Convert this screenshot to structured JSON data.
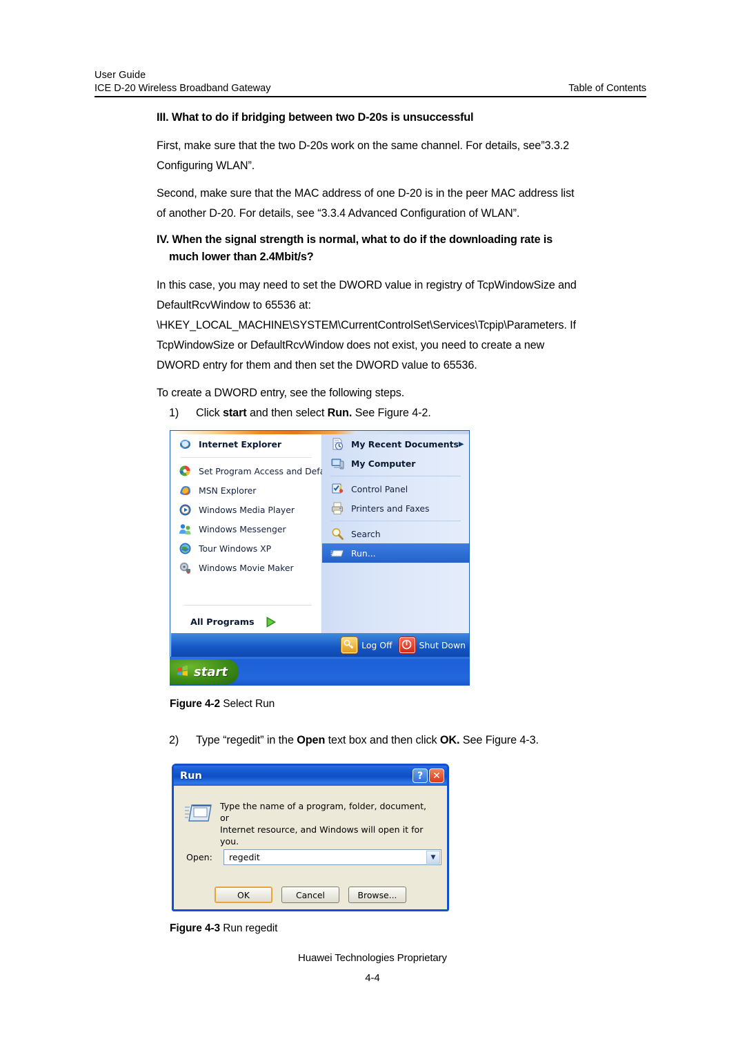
{
  "header": {
    "doc_type": "User Guide",
    "product": "ICE D-20 Wireless Broadband Gateway",
    "right_label": "Table of Contents"
  },
  "content": {
    "heading_3": "III. What to do if bridging between two D-20s is unsuccessful",
    "para_first_1": "First, make sure that the two D-20s work on the same channel. For details, see”3.3.2",
    "para_first_2": "Configuring WLAN”.",
    "para_second_1": "Second, make sure that the MAC address of one D-20 is in the peer MAC address list",
    "para_second_2": "of another D-20. For details, see “3.3.4  Advanced Configuration of WLAN”.",
    "heading_4_line1": "IV. When the signal strength is normal, what to do if the downloading rate is",
    "heading_4_line2": "much lower than 2.4Mbit/s?",
    "para_case_1": "In this case, you may need to set the DWORD value in registry of TcpWindowSize and",
    "para_case_2": "DefaultRcvWindow to 65536 at:",
    "para_case_3": "\\HKEY_LOCAL_MACHINE\\SYSTEM\\CurrentControlSet\\Services\\Tcpip\\Parameters. If",
    "para_case_4": "TcpWindowSize or DefaultRcvWindow does not exist, you need to create a new",
    "para_case_5": "DWORD entry for them and then set the DWORD value to 65536.",
    "para_steps_intro": "To create a DWORD entry, see the following steps.",
    "step1": {
      "number": "1)",
      "text_a": "Click ",
      "bold_a": "start",
      "text_b": " and then select ",
      "bold_b": "Run.",
      "text_c": " See Figure 4-2."
    },
    "step2": {
      "number": "2)",
      "text_a": "Type “regedit” in the ",
      "bold_a": "Open",
      "text_b": " text box and then click ",
      "bold_b": "OK.",
      "text_c": " See Figure 4-3."
    },
    "figure_4_2": {
      "label": "Figure 4-2",
      "caption": " Select Run"
    },
    "figure_4_3": {
      "label": "Figure 4-3",
      "caption": " Run regedit"
    }
  },
  "start_menu": {
    "left_items": [
      {
        "label": "Internet Explorer",
        "icon": "internet-explorer-icon",
        "bold": true
      },
      {
        "label": "Set Program Access and Defa…",
        "icon": "set-program-access-icon",
        "bold": false
      },
      {
        "label": "MSN Explorer",
        "icon": "msn-explorer-icon",
        "bold": false
      },
      {
        "label": "Windows Media Player",
        "icon": "windows-media-player-icon",
        "bold": false
      },
      {
        "label": "Windows Messenger",
        "icon": "windows-messenger-icon",
        "bold": false
      },
      {
        "label": "Tour Windows XP",
        "icon": "tour-windows-xp-icon",
        "bold": false
      },
      {
        "label": "Windows Movie Maker",
        "icon": "windows-movie-maker-icon",
        "bold": false
      }
    ],
    "all_programs": "All Programs",
    "right_items": [
      {
        "label": "My Recent Documents",
        "icon": "my-recent-documents-icon",
        "bold": true,
        "submenu": true
      },
      {
        "label": "My Computer",
        "icon": "my-computer-icon",
        "bold": true,
        "submenu": false
      },
      {
        "label": "Control Panel",
        "icon": "control-panel-icon",
        "bold": false,
        "submenu": false
      },
      {
        "label": "Printers and Faxes",
        "icon": "printers-and-faxes-icon",
        "bold": false,
        "submenu": false
      },
      {
        "label": "Search",
        "icon": "search-icon",
        "bold": false,
        "submenu": false
      },
      {
        "label": "Run...",
        "icon": "run-icon",
        "bold": false,
        "submenu": false,
        "selected": true
      }
    ],
    "log_off": "Log Off",
    "shut_down": "Shut Down",
    "start_button": "start",
    "colors": {
      "panel_border": "#1c5fc0",
      "right_panel": "#dbe6f8",
      "selection": "#2461cc",
      "taskbar": "#1d5fd6",
      "start_green": "#3b8a16"
    }
  },
  "run_dialog": {
    "title": "Run",
    "help_button": "?",
    "close_button": "✕",
    "description_line1": "Type the name of a program, folder, document, or",
    "description_line2": "Internet resource, and Windows will open it for you.",
    "open_label": "Open:",
    "open_value": "regedit",
    "buttons": {
      "ok": "OK",
      "cancel": "Cancel",
      "browse": "Browse..."
    },
    "colors": {
      "titlebar": "#0f4ec8",
      "face": "#ece9d8",
      "default_button_outline": "#e8a33d"
    }
  },
  "footer": {
    "proprietary": "Huawei Technologies Proprietary",
    "page_number": "4-4"
  }
}
